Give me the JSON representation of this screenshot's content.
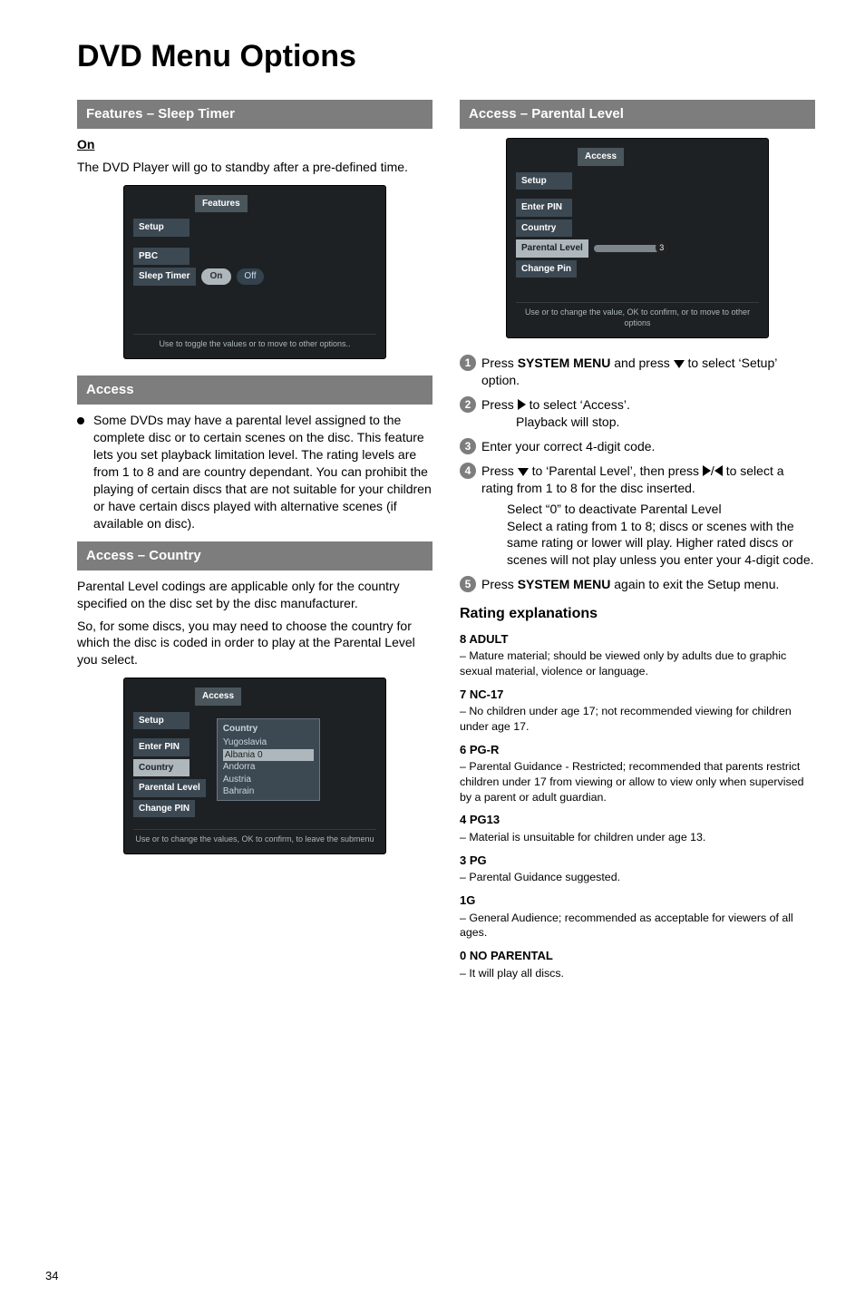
{
  "title": "DVD Menu Options",
  "pageNumber": "34",
  "left": {
    "sleepTimer": {
      "bar": "Features  –  Sleep Timer",
      "onLabel": "On",
      "onText": "The DVD Player will go to standby after a pre-defined time."
    },
    "fig1": {
      "heading": "Features",
      "tabs": {
        "setup": "Setup",
        "pbc": "PBC",
        "sleep": "Sleep Timer"
      },
      "onPill": "On",
      "offPill": "Off",
      "footer": "Use        to toggle the values   or   to move to other options.."
    },
    "access": {
      "bar": "Access",
      "bullet": "Some DVDs may have a parental level assigned to the complete disc or to certain scenes on the disc. This feature lets you set playback limitation level. The rating levels are from 1 to 8 and are country dependant. You can prohibit the playing of certain discs that are not suitable for your children or have certain discs played with alternative scenes (if available on disc)."
    },
    "country": {
      "bar": "Access –  Country",
      "p1": "Parental Level codings are applicable only for the country specified on the disc set by the disc manufacturer.",
      "p2": "So, for some discs, you may need to choose the country for which the disc is coded in order to play at the Parental Level you select."
    },
    "fig2": {
      "heading": "Access",
      "tabs": {
        "setup": "Setup",
        "enterpin": "Enter PIN",
        "country": "Country",
        "plevel": "Parental Level",
        "changepin": "Change PIN"
      },
      "listHead": "Country",
      "list": [
        "Yugoslavia",
        "Albania        0",
        "Andorra",
        "Austria",
        "Bahrain"
      ],
      "footer": "Use   or    to change the values, OK to confirm,    to leave the submenu"
    }
  },
  "right": {
    "parental": {
      "bar": "Access –  Parental Level"
    },
    "fig3": {
      "heading": "Access",
      "tabs": {
        "setup": "Setup",
        "enterpin": "Enter PIN",
        "country": "Country",
        "plevel": "Parental Level",
        "changepin": "Change Pin"
      },
      "footer": "Use   or    to change the value, OK to confirm,    or   to move to other options"
    },
    "steps": {
      "s1a": "Press ",
      "s1b": "SYSTEM MENU",
      "s1c": " and press ",
      "s1d": " to select ‘Setup’ option.",
      "s2a": "Press ",
      "s2b": " to select ‘Access’.",
      "s2c": "Playback will stop.",
      "s3": "Enter your correct 4-digit code.",
      "s4a": "Press ",
      "s4b": " to ‘Parental Level’, then press ",
      "s4c": " to select a rating from 1 to 8 for the disc inserted.",
      "s4d": "Select “0” to deactivate Parental Level",
      "s4e": "Select a rating from 1 to 8; discs or scenes with the same rating or lower will play. Higher rated discs or scenes will not play unless you enter your 4-digit code.",
      "s5a": "Press ",
      "s5b": "SYSTEM MENU",
      "s5c": " again to exit the Setup menu."
    },
    "ratings": {
      "title": "Rating explanations",
      "r8h": "8 ADULT",
      "r8": "–   Mature material; should be viewed only by adults due to graphic sexual material, violence or language.",
      "r7h": "7 NC-17",
      "r7": "–   No children under age 17; not recommended viewing for children under age 17.",
      "r6h": "6 PG-R",
      "r6": "–   Parental Guidance - Restricted; recommended that parents restrict children under 17 from viewing or allow to view only when supervised by a parent or adult guardian.",
      "r4h": "4 PG13",
      "r4": "–   Material is unsuitable for children under age 13.",
      "r3h": "3 PG",
      "r3": "–   Parental Guidance suggested.",
      "r1h": "1G",
      "r1": "–   General Audience; recommended as acceptable for viewers of all ages.",
      "r0h": "0 NO PARENTAL",
      "r0": "–   It will play all discs."
    }
  }
}
